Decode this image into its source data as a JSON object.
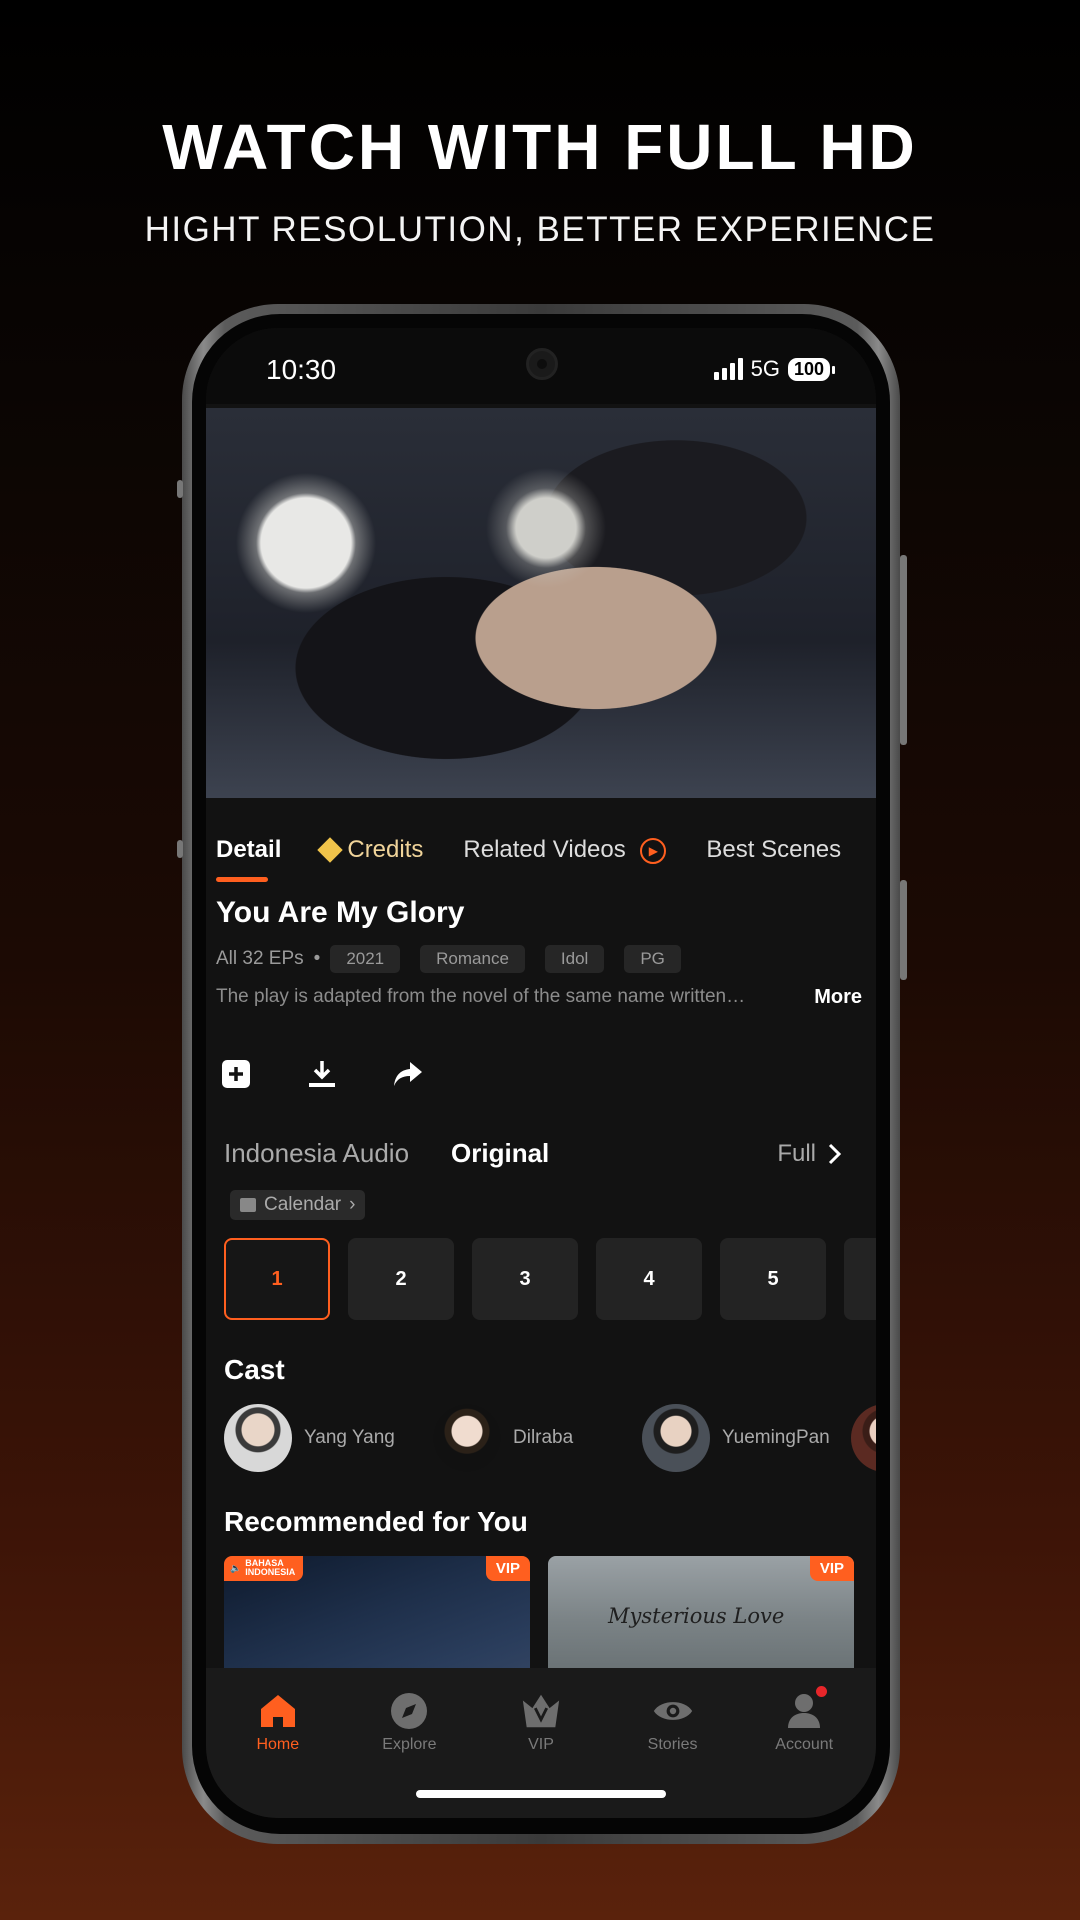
{
  "promo": {
    "headline": "WATCH WITH FULL HD",
    "subheadline": "HIGHT RESOLUTION, BETTER EXPERIENCE"
  },
  "status_bar": {
    "time": "10:30",
    "network": "5G",
    "battery": "100"
  },
  "tabs": [
    {
      "label": "Detail",
      "active": true
    },
    {
      "label": "Credits"
    },
    {
      "label": "Related Videos"
    },
    {
      "label": "Best Scenes"
    }
  ],
  "show": {
    "title": "You Are My Glory",
    "episodes": "All 32 EPs",
    "tags": [
      "2021",
      "Romance",
      "Idol",
      "PG"
    ],
    "description": "The play is adapted from the novel of the same name written…",
    "more_label": "More"
  },
  "actions": [
    "add-to-list-icon",
    "download-icon",
    "share-icon"
  ],
  "audio": {
    "options": [
      "Indonesia Audio",
      "Original"
    ],
    "selected": "Original",
    "full_label": "Full",
    "calendar_label": "Calendar"
  },
  "episode_list": [
    "1",
    "2",
    "3",
    "4",
    "5",
    ""
  ],
  "cast": {
    "title": "Cast",
    "members": [
      "Yang Yang",
      "Dilraba",
      "YuemingPan",
      ""
    ]
  },
  "recommended": {
    "title": "Recommended for You",
    "items": [
      {
        "badge": "VIP",
        "lang_badge": "BAHASA INDONESIA",
        "title": ""
      },
      {
        "badge": "VIP",
        "title": "Mysterious Love"
      }
    ]
  },
  "bottom_nav": [
    {
      "label": "Home",
      "icon": "home-icon",
      "active": true
    },
    {
      "label": "Explore",
      "icon": "compass-icon"
    },
    {
      "label": "VIP",
      "icon": "crown-icon"
    },
    {
      "label": "Stories",
      "icon": "eye-icon"
    },
    {
      "label": "Account",
      "icon": "user-icon",
      "notification": true
    }
  ],
  "colors": {
    "accent": "#ff5f1f",
    "background": "#121212"
  }
}
